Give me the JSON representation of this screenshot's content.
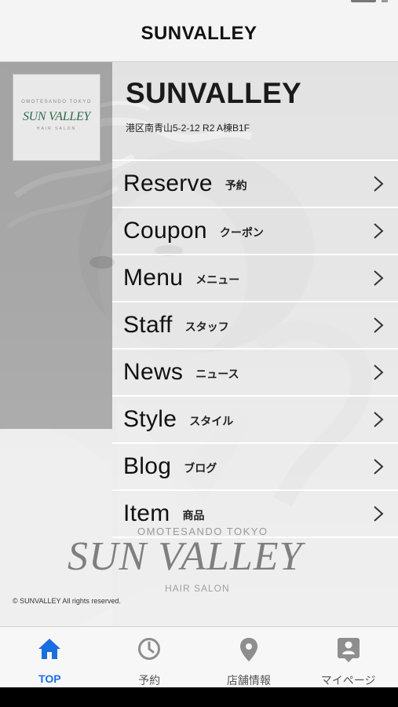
{
  "header": {
    "title": "SUNVALLEY"
  },
  "logo": {
    "line1": "OMOTESANDO TOKYO",
    "text": "SUN VALLEY",
    "line2": "HAIR SALON"
  },
  "salon": {
    "name": "SUNVALLEY",
    "address": "港区南青山5-2-12 R2 A棟B1F"
  },
  "menu": {
    "items": [
      {
        "en": "Reserve",
        "ja": "予約"
      },
      {
        "en": "Coupon",
        "ja": "クーポン"
      },
      {
        "en": "Menu",
        "ja": "メニュー"
      },
      {
        "en": "Staff",
        "ja": "スタッフ"
      },
      {
        "en": "News",
        "ja": "ニュース"
      },
      {
        "en": "Style",
        "ja": "スタイル"
      },
      {
        "en": "Blog",
        "ja": "ブログ"
      },
      {
        "en": "Item",
        "ja": "商品"
      }
    ]
  },
  "bottom_logo": {
    "top_line": "OMOTESANDO TOKYO",
    "big": "SUN VALLEY",
    "sub": "HAIR SALON"
  },
  "copyright": "© SUNVALLEY All rights reserved.",
  "tabbar": {
    "tabs": [
      {
        "label": "TOP",
        "icon": "home-icon",
        "active": true
      },
      {
        "label": "予約",
        "icon": "clock-icon",
        "active": false
      },
      {
        "label": "店舗情報",
        "icon": "map-pin-icon",
        "active": false
      },
      {
        "label": "マイページ",
        "icon": "profile-icon",
        "active": false
      }
    ]
  },
  "colors": {
    "accent": "#1a6fe0",
    "logo_green": "#2f6a4d",
    "tab_inactive": "#8e8e8e"
  }
}
